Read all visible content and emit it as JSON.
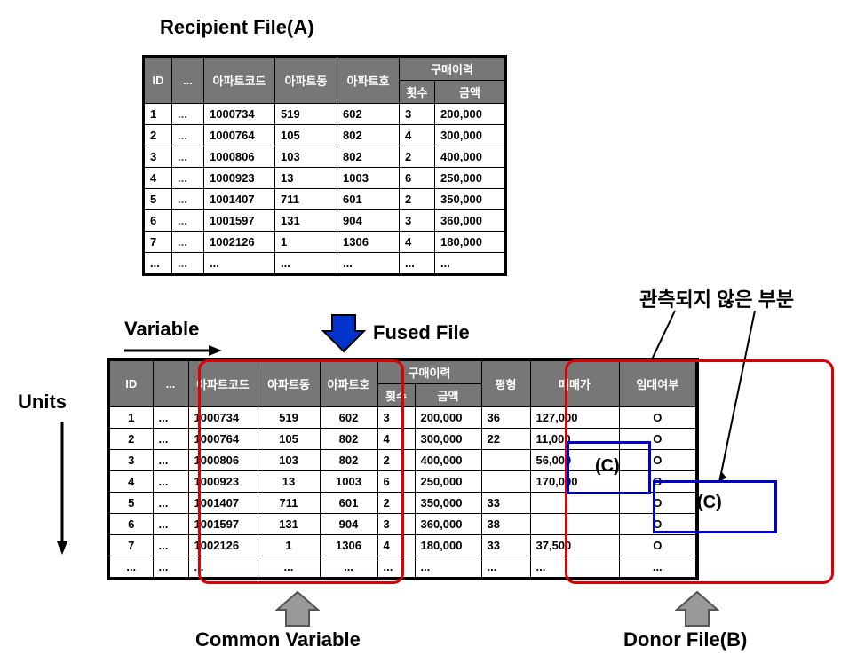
{
  "titles": {
    "recipient": "Recipient File(A)",
    "fused": "Fused File",
    "variable": "Variable",
    "units": "Units",
    "unobserved": "관측되지 않은 부분",
    "common_var": "Common Variable",
    "donor": "Donor File(B)",
    "c_label": "(C)"
  },
  "headers": {
    "id": "ID",
    "dots": "...",
    "apt_code": "아파트코드",
    "apt_dong": "아파트동",
    "apt_ho": "아파트호",
    "purchase_hist": "구매이력",
    "times": "횟수",
    "amount": "금액",
    "pyung": "평형",
    "price": "매매가",
    "rent": "임대여부"
  },
  "tableA": {
    "rows": [
      {
        "id": "1",
        "code": "1000734",
        "dong": "519",
        "ho": "602",
        "cnt": "3",
        "amt": "200,000"
      },
      {
        "id": "2",
        "code": "1000764",
        "dong": "105",
        "ho": "802",
        "cnt": "4",
        "amt": "300,000"
      },
      {
        "id": "3",
        "code": "1000806",
        "dong": "103",
        "ho": "802",
        "cnt": "2",
        "amt": "400,000"
      },
      {
        "id": "4",
        "code": "1000923",
        "dong": "13",
        "ho": "1003",
        "cnt": "6",
        "amt": "250,000"
      },
      {
        "id": "5",
        "code": "1001407",
        "dong": "711",
        "ho": "601",
        "cnt": "2",
        "amt": "350,000"
      },
      {
        "id": "6",
        "code": "1001597",
        "dong": "131",
        "ho": "904",
        "cnt": "3",
        "amt": "360,000"
      },
      {
        "id": "7",
        "code": "1002126",
        "dong": "1",
        "ho": "1306",
        "cnt": "4",
        "amt": "180,000"
      },
      {
        "id": "...",
        "code": "...",
        "dong": "...",
        "ho": "...",
        "cnt": "...",
        "amt": "..."
      }
    ]
  },
  "fused": {
    "rows": [
      {
        "id": "1",
        "code": "1000734",
        "dong": "519",
        "ho": "602",
        "cnt": "3",
        "amt": "200,000",
        "py": "36",
        "price": "127,000",
        "rent": "O"
      },
      {
        "id": "2",
        "code": "1000764",
        "dong": "105",
        "ho": "802",
        "cnt": "4",
        "amt": "300,000",
        "py": "22",
        "price": "11,000",
        "rent": "O"
      },
      {
        "id": "3",
        "code": "1000806",
        "dong": "103",
        "ho": "802",
        "cnt": "2",
        "amt": "400,000",
        "py": "",
        "price": "56,000",
        "rent": "O"
      },
      {
        "id": "4",
        "code": "1000923",
        "dong": "13",
        "ho": "1003",
        "cnt": "6",
        "amt": "250,000",
        "py": "",
        "price": "170,000",
        "rent": "O"
      },
      {
        "id": "5",
        "code": "1001407",
        "dong": "711",
        "ho": "601",
        "cnt": "2",
        "amt": "350,000",
        "py": "33",
        "price": "",
        "rent": "O"
      },
      {
        "id": "6",
        "code": "1001597",
        "dong": "131",
        "ho": "904",
        "cnt": "3",
        "amt": "360,000",
        "py": "38",
        "price": "",
        "rent": "O"
      },
      {
        "id": "7",
        "code": "1002126",
        "dong": "1",
        "ho": "1306",
        "cnt": "4",
        "amt": "180,000",
        "py": "33",
        "price": "37,500",
        "rent": "O"
      },
      {
        "id": "...",
        "code": "...",
        "dong": "...",
        "ho": "...",
        "cnt": "...",
        "amt": "...",
        "py": "...",
        "price": "...",
        "rent": "..."
      }
    ]
  }
}
